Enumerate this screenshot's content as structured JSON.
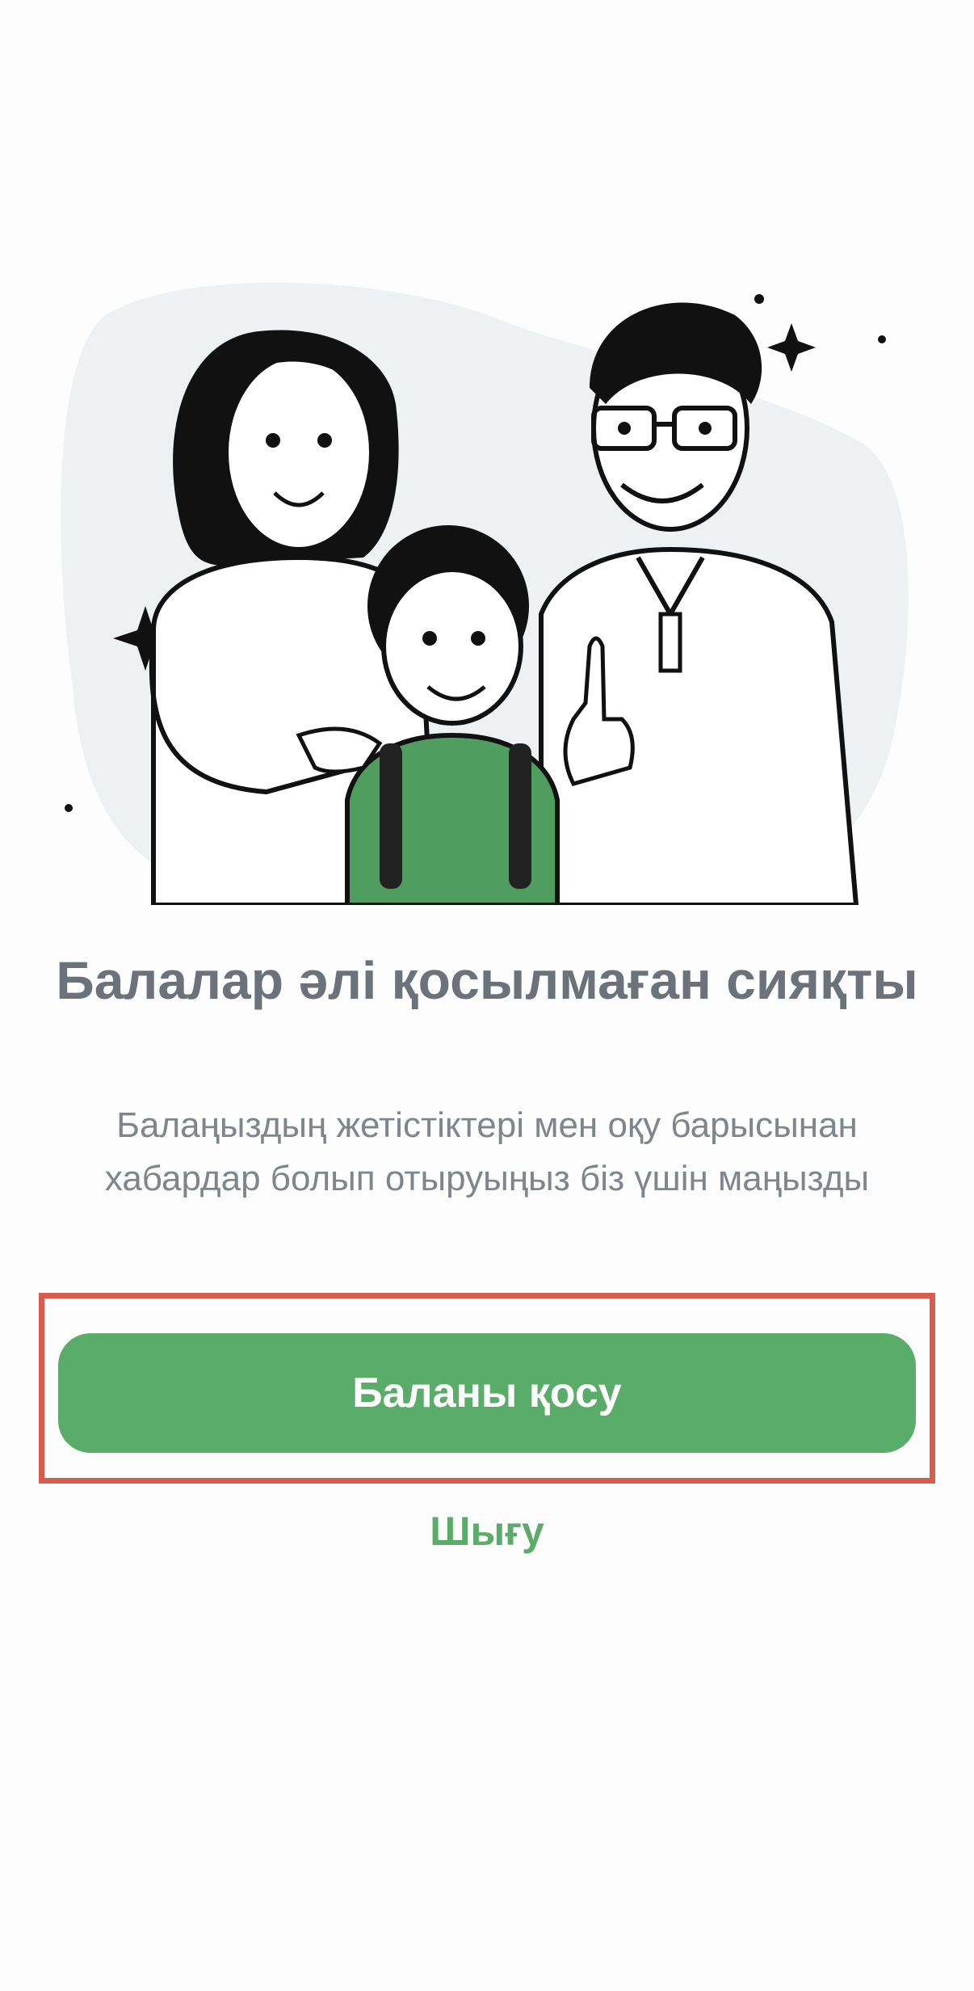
{
  "empty_state": {
    "title": "Балалар әлі қосылмаған сияқты",
    "subtitle": "Балаңыздың жетістіктері мен оқу барысынан хабардар болып отыруыңыз біз үшін маңызды",
    "illustration_icon": "family-illustration"
  },
  "actions": {
    "add_child_label": "Баланы қосу",
    "logout_label": "Шығу"
  },
  "colors": {
    "accent_green": "#5aad69",
    "title_gray": "#6c727a",
    "highlight_red": "#d95b4b"
  }
}
